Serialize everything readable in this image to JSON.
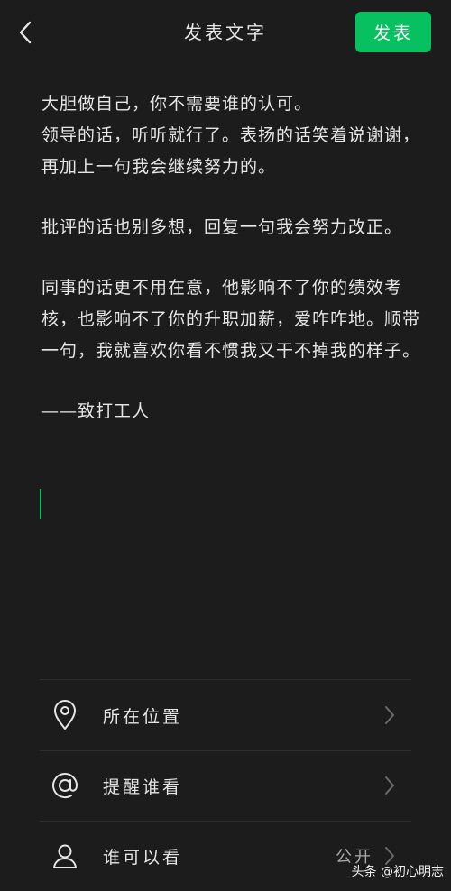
{
  "header": {
    "title": "发表文字",
    "publish_label": "发表"
  },
  "editor": {
    "paragraphs": [
      "大胆做自己，你不需要谁的认可。\n领导的话，听听就行了。表扬的话笑着说谢谢，再加上一句我会继续努力的。",
      "批评的话也别多想，回复一句我会努力改正。",
      "同事的话更不用在意，他影响不了你的绩效考核，也影响不了你的升职加薪，爱咋咋地。顺带一句，我就喜欢你看不惯我又干不掉我的样子。",
      "——致打工人"
    ]
  },
  "options": [
    {
      "label": "所在位置",
      "value": "",
      "icon": "location-icon"
    },
    {
      "label": "提醒谁看",
      "value": "",
      "icon": "at-icon"
    },
    {
      "label": "谁可以看",
      "value": "公开",
      "icon": "person-icon"
    }
  ],
  "watermark": "头条 @初心明志",
  "colors": {
    "accent": "#07c160",
    "background": "#1c1c1c"
  }
}
